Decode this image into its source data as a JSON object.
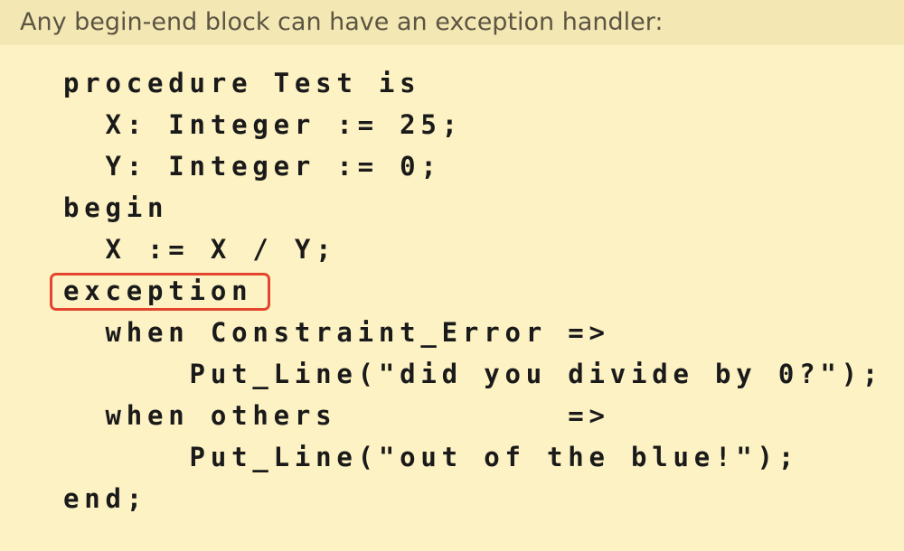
{
  "intro": "Any begin-end block can have an exception handler:",
  "code": {
    "lines": [
      "procedure Test is",
      "  X: Integer := 25;",
      "  Y: Integer := 0;",
      "begin",
      "  X := X / Y;",
      "exception",
      "  when Constraint_Error =>",
      "      Put_Line(\"did you divide by 0?\");",
      "  when others           =>",
      "      Put_Line(\"out of the blue!\");",
      "end;"
    ]
  },
  "colors": {
    "background": "#fdf2c4",
    "header_band": "#f3e7b4",
    "highlight_border": "#e2452e",
    "intro_text": "#5c5543",
    "code_text": "#1a1a1a"
  }
}
